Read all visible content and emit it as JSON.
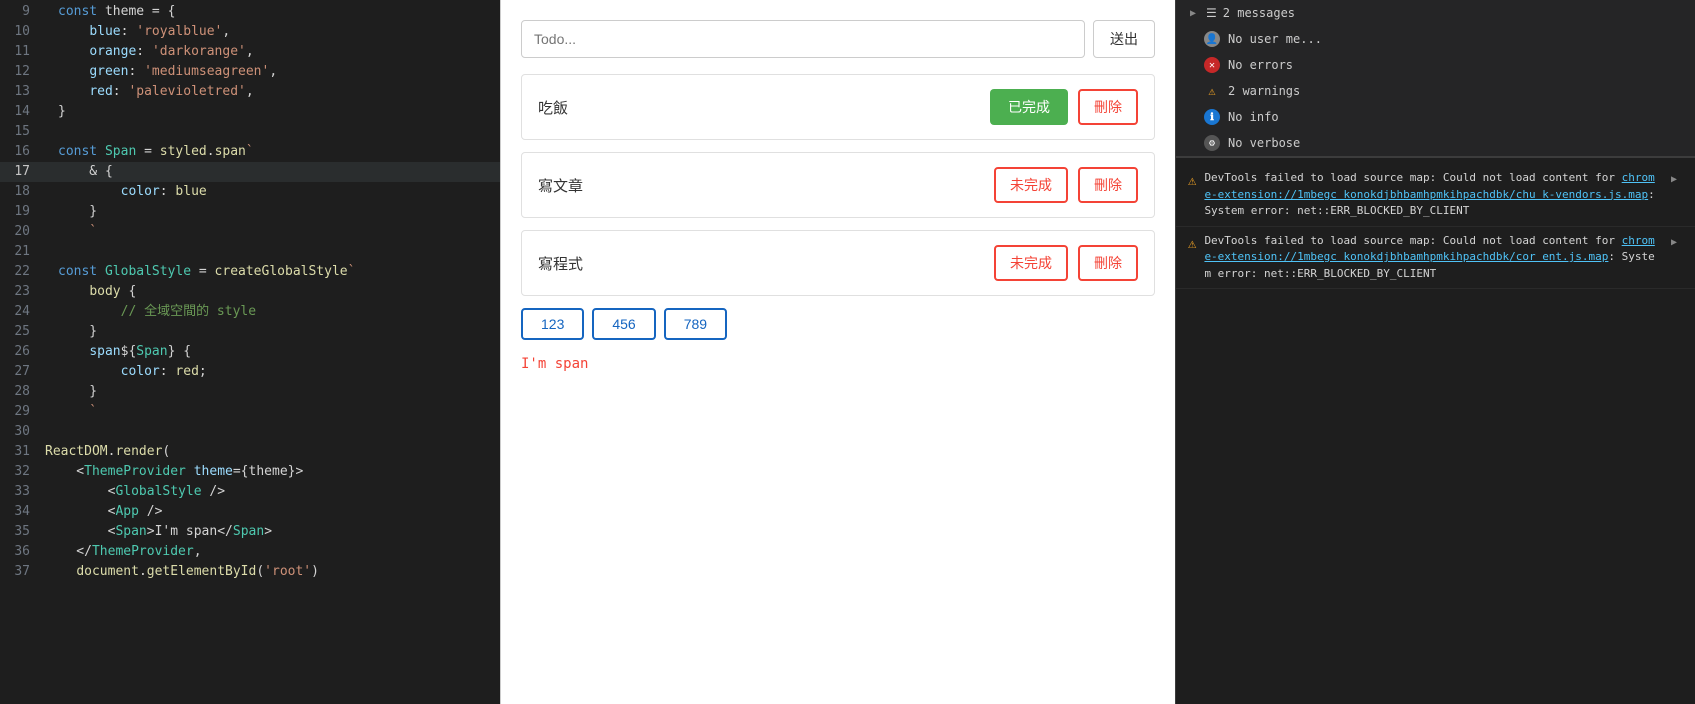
{
  "editor": {
    "lines": [
      {
        "num": 9,
        "highlight": false,
        "gutter": "",
        "content": [
          {
            "t": "kw",
            "v": "const"
          },
          {
            "t": "punc",
            "v": " theme = {"
          }
        ]
      },
      {
        "num": 10,
        "highlight": false,
        "gutter": "",
        "content": [
          {
            "t": "punc",
            "v": "    "
          },
          {
            "t": "prop",
            "v": "blue"
          },
          {
            "t": "punc",
            "v": ": "
          },
          {
            "t": "str",
            "v": "'royalblue'"
          },
          {
            "t": "punc",
            "v": ","
          }
        ]
      },
      {
        "num": 11,
        "highlight": false,
        "gutter": "",
        "content": [
          {
            "t": "punc",
            "v": "    "
          },
          {
            "t": "prop",
            "v": "orange"
          },
          {
            "t": "punc",
            "v": ": "
          },
          {
            "t": "str",
            "v": "'darkorange'"
          },
          {
            "t": "punc",
            "v": ","
          }
        ]
      },
      {
        "num": 12,
        "highlight": false,
        "gutter": "",
        "content": [
          {
            "t": "punc",
            "v": "    "
          },
          {
            "t": "prop",
            "v": "green"
          },
          {
            "t": "punc",
            "v": ": "
          },
          {
            "t": "str",
            "v": "'mediumseagreen'"
          },
          {
            "t": "punc",
            "v": ","
          }
        ]
      },
      {
        "num": 13,
        "highlight": false,
        "gutter": "",
        "content": [
          {
            "t": "punc",
            "v": "    "
          },
          {
            "t": "prop",
            "v": "red"
          },
          {
            "t": "punc",
            "v": ": "
          },
          {
            "t": "str",
            "v": "'palevioletred'"
          },
          {
            "t": "punc",
            "v": ","
          }
        ]
      },
      {
        "num": 14,
        "highlight": false,
        "gutter": "",
        "content": [
          {
            "t": "punc",
            "v": "}"
          }
        ]
      },
      {
        "num": 15,
        "highlight": false,
        "gutter": "",
        "content": []
      },
      {
        "num": 16,
        "highlight": false,
        "gutter": "",
        "content": [
          {
            "t": "kw",
            "v": "const"
          },
          {
            "t": "punc",
            "v": " "
          },
          {
            "t": "blue-var",
            "v": "Span"
          },
          {
            "t": "punc",
            "v": " = "
          },
          {
            "t": "fn",
            "v": "styled"
          },
          {
            "t": "punc",
            "v": "."
          },
          {
            "t": "fn",
            "v": "span"
          },
          {
            "t": "str",
            "v": "`"
          }
        ]
      },
      {
        "num": 17,
        "highlight": true,
        "gutter": "",
        "content": [
          {
            "t": "punc",
            "v": "    & {"
          }
        ]
      },
      {
        "num": 18,
        "highlight": false,
        "gutter": "",
        "content": [
          {
            "t": "punc",
            "v": "        "
          },
          {
            "t": "prop",
            "v": "color"
          },
          {
            "t": "punc",
            "v": ": "
          },
          {
            "t": "fn",
            "v": "blue"
          }
        ]
      },
      {
        "num": 19,
        "highlight": false,
        "gutter": "",
        "content": [
          {
            "t": "punc",
            "v": "    }"
          }
        ]
      },
      {
        "num": 20,
        "highlight": false,
        "gutter": "",
        "content": [
          {
            "t": "str",
            "v": "    `"
          }
        ]
      },
      {
        "num": 21,
        "highlight": false,
        "gutter": "",
        "content": []
      },
      {
        "num": 22,
        "highlight": false,
        "gutter": "",
        "content": [
          {
            "t": "kw",
            "v": "const"
          },
          {
            "t": "punc",
            "v": " "
          },
          {
            "t": "blue-var",
            "v": "GlobalStyle"
          },
          {
            "t": "punc",
            "v": " = "
          },
          {
            "t": "fn",
            "v": "createGlobalStyle"
          },
          {
            "t": "str",
            "v": "`"
          }
        ]
      },
      {
        "num": 23,
        "highlight": false,
        "gutter": "",
        "content": [
          {
            "t": "punc",
            "v": "    "
          },
          {
            "t": "fn",
            "v": "body"
          },
          {
            "t": "punc",
            "v": " {"
          }
        ]
      },
      {
        "num": 24,
        "highlight": false,
        "gutter": "",
        "content": [
          {
            "t": "punc",
            "v": "        "
          },
          {
            "t": "comment",
            "v": "// 全域空間的 style"
          }
        ]
      },
      {
        "num": 25,
        "highlight": false,
        "gutter": "",
        "content": [
          {
            "t": "punc",
            "v": "    }"
          }
        ]
      },
      {
        "num": 26,
        "highlight": false,
        "gutter": "",
        "content": [
          {
            "t": "punc",
            "v": "    "
          },
          {
            "t": "prop",
            "v": "span"
          },
          {
            "t": "punc",
            "v": "${"
          },
          {
            "t": "blue-var",
            "v": "Span"
          },
          {
            "t": "punc",
            "v": "} {"
          }
        ]
      },
      {
        "num": 27,
        "highlight": false,
        "gutter": "",
        "content": [
          {
            "t": "punc",
            "v": "        "
          },
          {
            "t": "prop",
            "v": "color"
          },
          {
            "t": "punc",
            "v": ": "
          },
          {
            "t": "fn",
            "v": "red"
          },
          {
            "t": "punc",
            "v": ";"
          }
        ]
      },
      {
        "num": 28,
        "highlight": false,
        "gutter": "",
        "content": [
          {
            "t": "punc",
            "v": "    }"
          }
        ]
      },
      {
        "num": 29,
        "highlight": false,
        "gutter": "",
        "content": [
          {
            "t": "str",
            "v": "    `"
          }
        ]
      },
      {
        "num": 30,
        "highlight": false,
        "gutter": "",
        "content": []
      },
      {
        "num": 31,
        "highlight": false,
        "gutter": "yellow",
        "content": [
          {
            "t": "fn",
            "v": "ReactDOM"
          },
          {
            "t": "punc",
            "v": "."
          },
          {
            "t": "fn",
            "v": "render"
          },
          {
            "t": "punc",
            "v": "("
          }
        ]
      },
      {
        "num": 32,
        "highlight": false,
        "gutter": "yellow",
        "content": [
          {
            "t": "punc",
            "v": "    <"
          },
          {
            "t": "tag",
            "v": "ThemeProvider"
          },
          {
            "t": "punc",
            "v": " "
          },
          {
            "t": "attr",
            "v": "theme"
          },
          {
            "t": "punc",
            "v": "={"
          },
          {
            "t": "punc",
            "v": "theme"
          },
          {
            "t": "punc",
            "v": "}>"
          }
        ]
      },
      {
        "num": 33,
        "highlight": false,
        "gutter": "yellow",
        "content": [
          {
            "t": "punc",
            "v": "        <"
          },
          {
            "t": "tag",
            "v": "GlobalStyle"
          },
          {
            "t": "punc",
            "v": " />"
          }
        ]
      },
      {
        "num": 34,
        "highlight": false,
        "gutter": "yellow",
        "content": [
          {
            "t": "punc",
            "v": "        <"
          },
          {
            "t": "tag",
            "v": "App"
          },
          {
            "t": "punc",
            "v": " />"
          }
        ]
      },
      {
        "num": 35,
        "highlight": false,
        "gutter": "yellow",
        "content": [
          {
            "t": "punc",
            "v": "        <"
          },
          {
            "t": "tag",
            "v": "Span"
          },
          {
            "t": "punc",
            "v": ">"
          },
          {
            "t": "punc",
            "v": "I'm span"
          },
          {
            "t": "punc",
            "v": "</"
          },
          {
            "t": "tag",
            "v": "Span"
          },
          {
            "t": "punc",
            "v": ">"
          }
        ]
      },
      {
        "num": 36,
        "highlight": false,
        "gutter": "yellow",
        "content": [
          {
            "t": "punc",
            "v": "    </"
          },
          {
            "t": "tag",
            "v": "ThemeProvider"
          },
          {
            "t": "punc",
            "v": ","
          }
        ]
      },
      {
        "num": 37,
        "highlight": false,
        "gutter": "yellow",
        "content": [
          {
            "t": "punc",
            "v": "    "
          },
          {
            "t": "fn",
            "v": "document"
          },
          {
            "t": "punc",
            "v": "."
          },
          {
            "t": "fn",
            "v": "getElementById"
          },
          {
            "t": "punc",
            "v": "("
          },
          {
            "t": "str",
            "v": "'root'"
          },
          {
            "t": "punc",
            "v": ")"
          }
        ]
      }
    ]
  },
  "app": {
    "input_placeholder": "Todo...",
    "submit_btn": "送出",
    "todos": [
      {
        "text": "吃飯",
        "status": "done",
        "done_label": "已完成",
        "delete_label": "刪除"
      },
      {
        "text": "寫文章",
        "status": "incomplete",
        "incomplete_label": "未完成",
        "delete_label": "刪除"
      },
      {
        "text": "寫程式",
        "status": "incomplete",
        "incomplete_label": "未完成",
        "delete_label": "刪除"
      }
    ],
    "pages": [
      "123",
      "456",
      "789"
    ],
    "span_text": "I'm span"
  },
  "devtools": {
    "messages_section": {
      "arrow": "▶",
      "label": "2 messages"
    },
    "console_items": [
      {
        "icon": "user",
        "icon_type": "grey",
        "label": "No user me..."
      },
      {
        "icon": "error",
        "icon_type": "red",
        "label": "No errors"
      },
      {
        "icon": "warning",
        "icon_type": "warn",
        "label": "2 warnings"
      },
      {
        "icon": "info",
        "icon_type": "blue",
        "label": "No info"
      },
      {
        "icon": "verbose",
        "icon_type": "dark",
        "label": "No verbose"
      }
    ],
    "errors": [
      {
        "type": "warn",
        "text1": "DevTools failed to load source map: Could not load content for ",
        "link1": "chrome-extension://1mbegc konokdjbhbamhpmkihpachdbk/chu k-vendors.js.map",
        "text2": ": System error: net::ERR_BLOCKED_BY_CLIENT"
      },
      {
        "type": "warn",
        "text1": "DevTools failed to load source map: Could not load content for ",
        "link1": "chrome-extension://1mbegc konokdjbhbamhpmkihpachdbk/cor ent.js.map",
        "text2": ": System error: net::ERR_BLOCKED_BY_CLIENT"
      }
    ],
    "expand_arrow": "▶"
  }
}
